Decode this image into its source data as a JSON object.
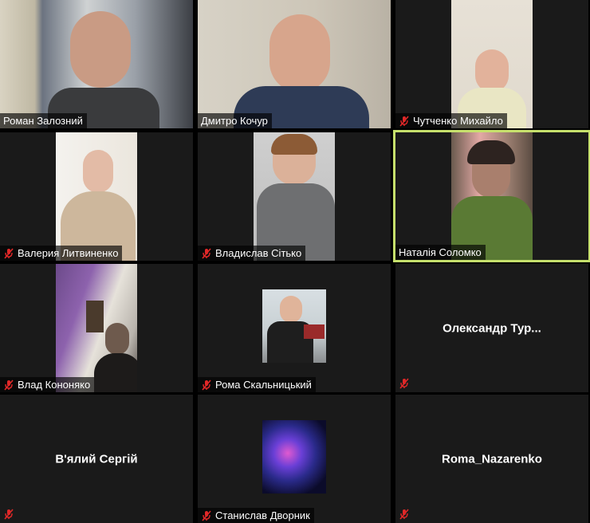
{
  "participants": [
    {
      "name": "Роман Залозний",
      "muted": false
    },
    {
      "name": "Дмитро Кочур",
      "muted": false
    },
    {
      "name": "Чутченко Михайло",
      "muted": true
    },
    {
      "name": "Валерия Литвиненко",
      "muted": true
    },
    {
      "name": "Владислав Сітько",
      "muted": true
    },
    {
      "name": "Наталія Соломко",
      "muted": false,
      "active_speaker": true
    },
    {
      "name": "Влад Кононяко",
      "muted": true
    },
    {
      "name": "Рома Скальницький",
      "muted": true
    },
    {
      "name": "Олександр  Тур...",
      "muted": true,
      "video_off": true
    },
    {
      "name": "В'ялий Сергій",
      "muted": true,
      "video_off": true
    },
    {
      "name": "Станислав Дворник",
      "muted": true
    },
    {
      "name": "Roma_Nazarenko",
      "muted": true,
      "video_off": true
    }
  ],
  "colors": {
    "active_border": "#c6e06c",
    "mute_icon": "#e02828",
    "tile_bg": "#1a1a1a"
  }
}
